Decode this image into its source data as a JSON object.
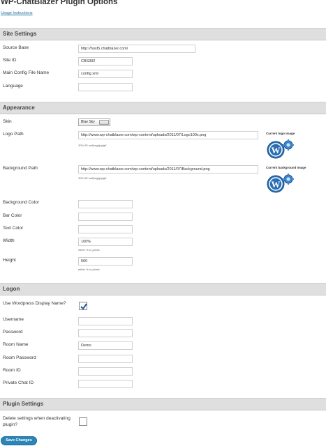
{
  "page_title": "WP-ChatBlazer Plugin Options",
  "usage_link": "Usage Instructions",
  "site_settings": {
    "header": "Site Settings",
    "source_base_label": "Source Base",
    "source_base_value": "http://host5.chatblazer.com/",
    "site_id_label": "Site ID",
    "site_id_value": "CBS392",
    "main_config_label": "Main Config File Name",
    "main_config_value": "config.xml",
    "language_label": "Language",
    "language_value": ""
  },
  "appearance": {
    "header": "Appearance",
    "skin_label": "Skin",
    "skin_value": "Blue Sky",
    "logo_path_label": "Logo Path",
    "logo_path_value": "http://www.wp-chatblazer.com/wp-content/uploads/2011/07/Logo100x.png",
    "logo_hint": "300×30 swf/png/jpg/gif",
    "current_logo_caption": "Current logo image",
    "background_path_label": "Background Path",
    "background_path_value": "http://www.wp-chatblazer.com/wp-content/uploads/2011/07/Background.png",
    "background_hint": "300×30 swf/png/jpg/gif",
    "current_background_caption": "Current background image",
    "background_color_label": "Background Color",
    "bar_color_label": "Bar Color",
    "text_color_label": "Text Color",
    "width_label": "Width",
    "width_value": "100%",
    "width_hint": "either % or pixels",
    "height_label": "Height",
    "height_value": "500",
    "height_hint": "either % or pixels"
  },
  "logon": {
    "header": "Logon",
    "use_display_name_label": "Use Wordpress Display Name?",
    "use_display_name_checked": true,
    "username_label": "Username",
    "password_label": "Password",
    "room_name_label": "Room Name",
    "room_name_value": "Demo",
    "room_password_label": "Room Password",
    "room_id_label": "Room ID",
    "private_chat_id_label": "Private Chat ID"
  },
  "plugin_settings": {
    "header": "Plugin Settings",
    "delete_settings_label": "Delete settings when deactivating plugin?",
    "delete_settings_checked": false
  },
  "save_button": "Save Changes",
  "colors": {
    "section_bg": "#dfdfdf",
    "button": "#2b85b9",
    "link": "#21759b",
    "wp_logo_blue": "#2a6fb3"
  }
}
